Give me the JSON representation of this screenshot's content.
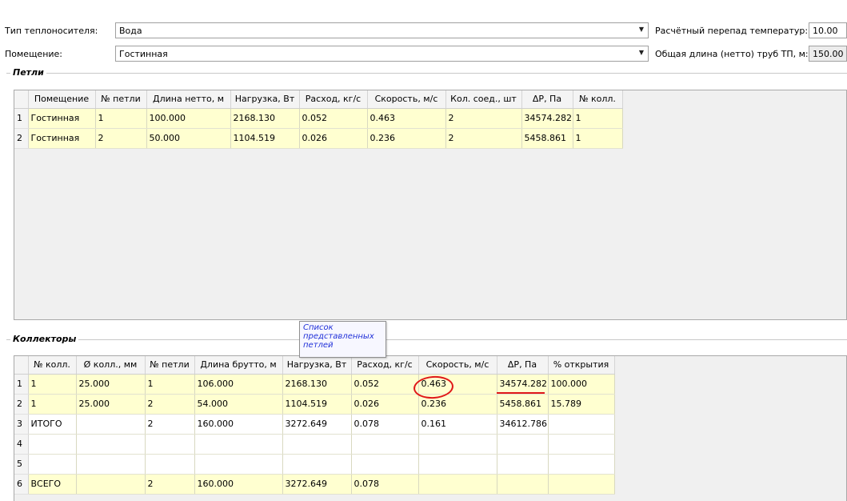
{
  "header": {
    "coolant_label": "Тип теплоносителя:",
    "coolant_value": "Вода",
    "room_label": "Помещение:",
    "room_value": "Гостинная",
    "temp_drop_label": "Расчётный перепад температур:",
    "temp_drop_value": "10.00",
    "pipe_length_label": "Общая длина (нетто) труб ТП, м:",
    "pipe_length_value": "150.00"
  },
  "loops": {
    "title": "Петли",
    "columns": [
      "Помещение",
      "№ петли",
      "Длина нетто, м",
      "Нагрузка, Вт",
      "Расход, кг/с",
      "Скорость, м/с",
      "Кол. соед., шт",
      "ΔP, Па",
      "№ колл."
    ],
    "rows": [
      {
        "n": "1",
        "cells": [
          "Гостинная",
          "1",
          "100.000",
          "2168.130",
          "0.052",
          "0.463",
          "2",
          "34574.282",
          "1"
        ]
      },
      {
        "n": "2",
        "cells": [
          "Гостинная",
          "2",
          "50.000",
          "1104.519",
          "0.026",
          "0.236",
          "2",
          "5458.861",
          "1"
        ]
      }
    ]
  },
  "collectors": {
    "title": "Коллекторы",
    "columns": [
      "№ колл.",
      "Ø колл., мм",
      "№ петли",
      "Длина брутто, м",
      "Нагрузка, Вт",
      "Расход, кг/с",
      "Скорость, м/с",
      "ΔP, Па",
      "% открытия"
    ],
    "rows": [
      {
        "n": "1",
        "style": "hl",
        "cells": [
          "1",
          "25.000",
          "1",
          "106.000",
          "2168.130",
          "0.052",
          "0.463",
          "34574.282",
          "100.000"
        ]
      },
      {
        "n": "2",
        "style": "hl",
        "cells": [
          "1",
          "25.000",
          "2",
          "54.000",
          "1104.519",
          "0.026",
          "0.236",
          "5458.861",
          "15.789"
        ]
      },
      {
        "n": "3",
        "style": "wt",
        "cells": [
          "ИТОГО",
          "",
          "2",
          "160.000",
          "3272.649",
          "0.078",
          "0.161",
          "34612.786",
          ""
        ]
      },
      {
        "n": "4",
        "style": "wt",
        "cells": [
          "",
          "",
          "",
          "",
          "",
          "",
          "",
          "",
          ""
        ]
      },
      {
        "n": "5",
        "style": "wt",
        "cells": [
          "",
          "",
          "",
          "",
          "",
          "",
          "",
          "",
          ""
        ]
      },
      {
        "n": "6",
        "style": "hl",
        "cells": [
          "ВСЕГО",
          "",
          "2",
          "160.000",
          "3272.649",
          "0.078",
          "",
          "",
          ""
        ]
      }
    ]
  },
  "tooltip": {
    "text": "Список представленных петлей"
  },
  "annotation_color": "#e01818",
  "highlight_row_color": "#ffffd0"
}
